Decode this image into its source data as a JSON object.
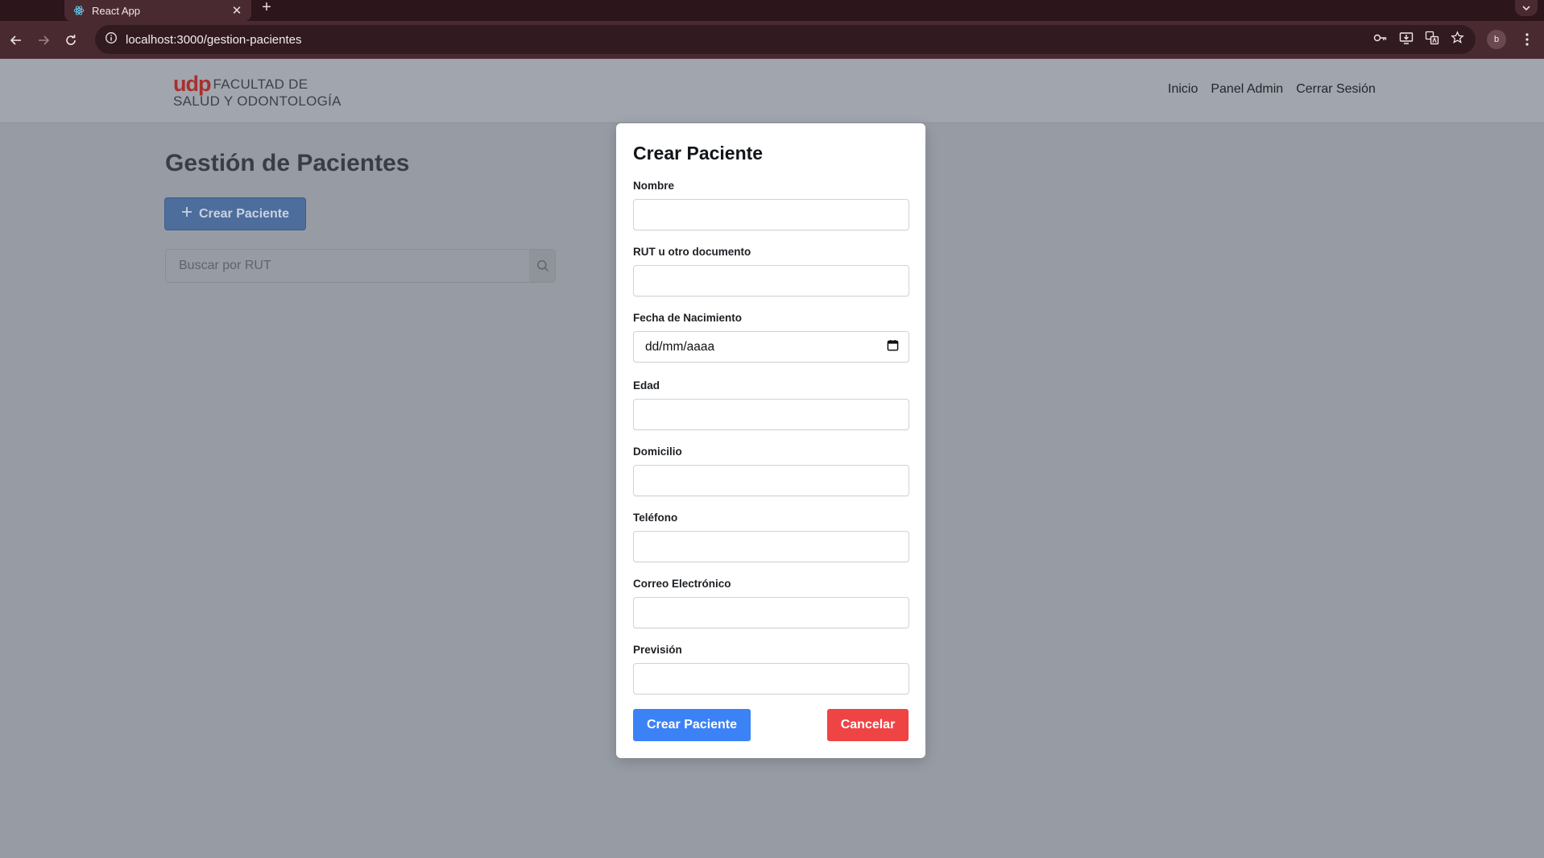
{
  "browser": {
    "tab_title": "React App",
    "url": "localhost:3000/gestion-pacientes",
    "profile_initial": "b"
  },
  "header": {
    "logo_brand": "udp",
    "logo_line1": "FACULTAD DE",
    "logo_line2": "SALUD Y ODONTOLOGÍA",
    "nav": [
      "Inicio",
      "Panel Admin",
      "Cerrar Sesión"
    ]
  },
  "main": {
    "title": "Gestión de Pacientes",
    "create_button": "Crear Paciente",
    "search_placeholder": "Buscar por RUT"
  },
  "modal": {
    "title": "Crear Paciente",
    "fields": [
      {
        "label": "Nombre",
        "value": ""
      },
      {
        "label": "RUT u otro documento",
        "value": ""
      },
      {
        "label": "Fecha de Nacimiento",
        "value": "dd/mm/aaaa"
      },
      {
        "label": "Edad",
        "value": ""
      },
      {
        "label": "Domicilio",
        "value": ""
      },
      {
        "label": "Teléfono",
        "value": ""
      },
      {
        "label": "Correo Electrónico",
        "value": ""
      },
      {
        "label": "Previsión",
        "value": ""
      }
    ],
    "submit_label": "Crear Paciente",
    "cancel_label": "Cancelar"
  },
  "colors": {
    "primary": "#3b82f6",
    "danger": "#ef4444",
    "brand": "#a8302f"
  }
}
